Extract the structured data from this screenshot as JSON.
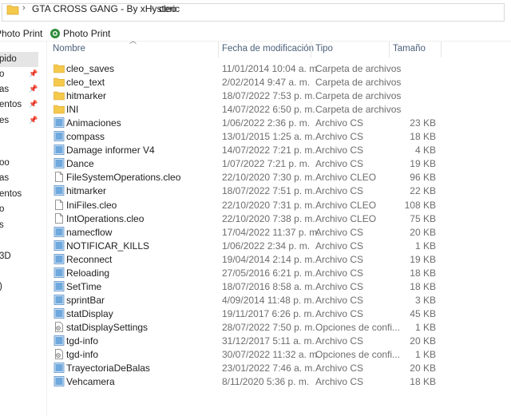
{
  "address": {
    "crumbs": [
      "GTA CROSS GANG - By xHysteric",
      "cleo"
    ],
    "separator": "›"
  },
  "toolbar": {
    "items": [
      "Photo Print",
      "Photo Print"
    ]
  },
  "nav": {
    "items": [
      {
        "label": "pido",
        "pinned": false,
        "selected": true
      },
      {
        "label": "o",
        "pinned": true
      },
      {
        "label": "as",
        "pinned": true
      },
      {
        "label": "entos",
        "pinned": true
      },
      {
        "label": "es",
        "pinned": true
      },
      {
        "label": "oo",
        "pinned": false
      },
      {
        "label": "as",
        "pinned": false
      },
      {
        "label": "entos",
        "pinned": false
      },
      {
        "label": "o",
        "pinned": false
      },
      {
        "label": "s",
        "pinned": false
      },
      {
        "label": "3D",
        "pinned": false
      },
      {
        "label": ")",
        "pinned": false
      }
    ]
  },
  "columns": {
    "name": "Nombre",
    "date": "Fecha de modificación",
    "type": "Tipo",
    "size": "Tamaño"
  },
  "files": [
    {
      "name": "cleo_saves",
      "date": "11/01/2014 10:04 a. m.",
      "type": "Carpeta de archivos",
      "size": "",
      "icon": "folder"
    },
    {
      "name": "cleo_text",
      "date": "2/02/2014 9:47 a. m.",
      "type": "Carpeta de archivos",
      "size": "",
      "icon": "folder"
    },
    {
      "name": "hitmarker",
      "date": "18/07/2022 7:53 p. m.",
      "type": "Carpeta de archivos",
      "size": "",
      "icon": "folder"
    },
    {
      "name": "INI",
      "date": "14/07/2022 6:50 p. m.",
      "type": "Carpeta de archivos",
      "size": "",
      "icon": "folder"
    },
    {
      "name": "Animaciones",
      "date": "1/06/2022 2:36 p. m.",
      "type": "Archivo CS",
      "size": "23 KB",
      "icon": "cs"
    },
    {
      "name": "compass",
      "date": "13/01/2015 1:25 a. m.",
      "type": "Archivo CS",
      "size": "18 KB",
      "icon": "cs"
    },
    {
      "name": "Damage informer V4",
      "date": "14/07/2022 7:21 p. m.",
      "type": "Archivo CS",
      "size": "4 KB",
      "icon": "cs"
    },
    {
      "name": "Dance",
      "date": "1/07/2022 7:21 p. m.",
      "type": "Archivo CS",
      "size": "19 KB",
      "icon": "cs"
    },
    {
      "name": "FileSystemOperations.cleo",
      "date": "22/10/2020 7:30 p. m.",
      "type": "Archivo CLEO",
      "size": "96 KB",
      "icon": "doc"
    },
    {
      "name": "hitmarker",
      "date": "18/07/2022 7:51 p. m.",
      "type": "Archivo CS",
      "size": "22 KB",
      "icon": "cs"
    },
    {
      "name": "IniFiles.cleo",
      "date": "22/10/2020 7:31 p. m.",
      "type": "Archivo CLEO",
      "size": "108 KB",
      "icon": "doc"
    },
    {
      "name": "IntOperations.cleo",
      "date": "22/10/2020 7:38 p. m.",
      "type": "Archivo CLEO",
      "size": "75 KB",
      "icon": "doc"
    },
    {
      "name": "namecflow",
      "date": "17/04/2022 11:37 p. m.",
      "type": "Archivo CS",
      "size": "20 KB",
      "icon": "cs"
    },
    {
      "name": "NOTIFICAR_KILLS",
      "date": "1/06/2022 2:34 p. m.",
      "type": "Archivo CS",
      "size": "1 KB",
      "icon": "cs"
    },
    {
      "name": "Reconnect",
      "date": "19/04/2014 2:14 p. m.",
      "type": "Archivo CS",
      "size": "19 KB",
      "icon": "cs"
    },
    {
      "name": "Reloading",
      "date": "27/05/2016 6:21 p. m.",
      "type": "Archivo CS",
      "size": "18 KB",
      "icon": "cs"
    },
    {
      "name": "SetTime",
      "date": "18/07/2016 8:58 a. m.",
      "type": "Archivo CS",
      "size": "18 KB",
      "icon": "cs"
    },
    {
      "name": "sprintBar",
      "date": "4/09/2014 11:48 p. m.",
      "type": "Archivo CS",
      "size": "3 KB",
      "icon": "cs"
    },
    {
      "name": "statDisplay",
      "date": "19/11/2017 6:26 p. m.",
      "type": "Archivo CS",
      "size": "45 KB",
      "icon": "cs"
    },
    {
      "name": "statDisplaySettings",
      "date": "28/07/2022 7:50 p. m.",
      "type": "Opciones de confi...",
      "size": "1 KB",
      "icon": "ini"
    },
    {
      "name": "tgd-info",
      "date": "31/12/2017 5:11 a. m.",
      "type": "Archivo CS",
      "size": "20 KB",
      "icon": "cs"
    },
    {
      "name": "tgd-info",
      "date": "30/07/2022 11:32 a. m.",
      "type": "Opciones de confi...",
      "size": "1 KB",
      "icon": "ini"
    },
    {
      "name": "TrayectoriaDeBalas",
      "date": "23/01/2022 7:46 a. m.",
      "type": "Archivo CS",
      "size": "20 KB",
      "icon": "cs"
    },
    {
      "name": "Vehcamera",
      "date": "8/11/2020 5:36 p. m.",
      "type": "Archivo CS",
      "size": "18 KB",
      "icon": "cs"
    }
  ],
  "colors": {
    "folder": "#f5c94c",
    "cs_icon": "#6fa8dc",
    "header_text": "#4c607a",
    "selected_bg": "#e5e5e5"
  }
}
